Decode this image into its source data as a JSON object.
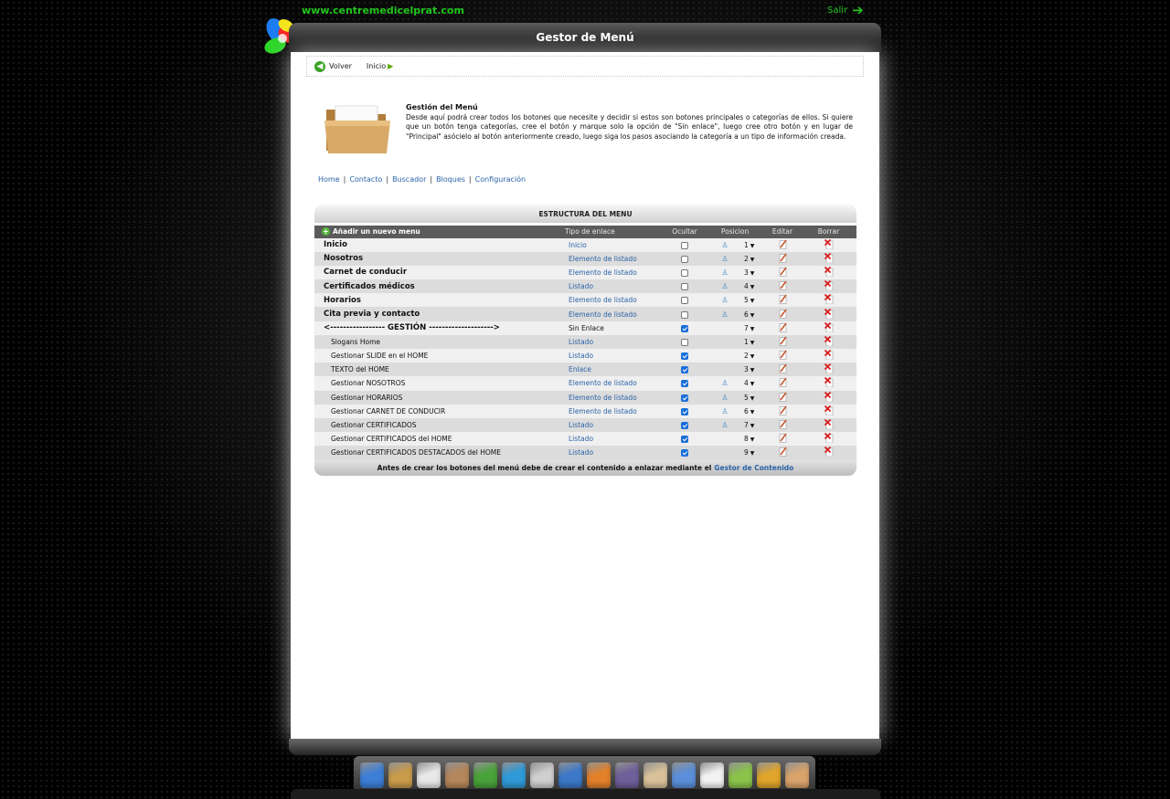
{
  "header": {
    "site_url": "www.centremedicelprat.com",
    "logout_label": "Salir",
    "page_title": "Gestor de Menú"
  },
  "breadcrumb": {
    "back_label": "Volver",
    "home_label": "Inicio"
  },
  "intro": {
    "title": "Gestión del Menú",
    "text": "Desde aquí podrá crear todos los botones que necesite y decidir si estos son botones principales o categorías de ellos. Si quiere que un botón tenga categorías, cree el botón y marque solo la opción de \"Sin enlace\", luego cree otro botón y en lugar de \"Principal\" asócielo al botón anteriormente creado, luego siga los pasos asociando la categoría a un tipo de información creada."
  },
  "quicklinks": [
    "Home",
    "Contacto",
    "Buscador",
    "Bloques",
    "Configuración"
  ],
  "menu_structure": {
    "title": "ESTRUCTURA DEL MENU",
    "add_label": "Añadir un nuevo menu",
    "columns": {
      "type": "Tipo de enlace",
      "hide": "Ocultar",
      "position": "Posicion",
      "edit": "Editar",
      "delete": "Borrar"
    },
    "rows": [
      {
        "name": "Inicio",
        "type": "Inicio",
        "hidden": false,
        "preview": true,
        "position": "1",
        "level": "main"
      },
      {
        "name": "Nosotros",
        "type": "Elemento de listado",
        "hidden": false,
        "preview": true,
        "position": "2",
        "level": "main"
      },
      {
        "name": "Carnet de conducir",
        "type": "Elemento de listado",
        "hidden": false,
        "preview": true,
        "position": "3",
        "level": "main"
      },
      {
        "name": "Certificados médicos",
        "type": "Listado",
        "hidden": false,
        "preview": true,
        "position": "4",
        "level": "main"
      },
      {
        "name": "Horarios",
        "type": "Elemento de listado",
        "hidden": false,
        "preview": true,
        "position": "5",
        "level": "main"
      },
      {
        "name": "Cita previa y contacto",
        "type": "Elemento de listado",
        "hidden": false,
        "preview": true,
        "position": "6",
        "level": "main"
      },
      {
        "name": "<----------------- GESTIÓN -------------------->",
        "type": "Sin Enlace",
        "hidden": true,
        "preview": false,
        "position": "7",
        "level": "main"
      },
      {
        "name": "Slogans Home",
        "type": "Listado",
        "hidden": false,
        "preview": false,
        "position": "1",
        "level": "sub"
      },
      {
        "name": "Gestionar SLIDE en el HOME",
        "type": "Listado",
        "hidden": true,
        "preview": false,
        "position": "2",
        "level": "sub"
      },
      {
        "name": "TEXTO del HOME",
        "type": "Enlace",
        "hidden": true,
        "preview": false,
        "position": "3",
        "level": "sub"
      },
      {
        "name": "Gestionar NOSOTROS",
        "type": "Elemento de listado",
        "hidden": true,
        "preview": true,
        "position": "4",
        "level": "sub"
      },
      {
        "name": "Gestionar HORARIOS",
        "type": "Elemento de listado",
        "hidden": true,
        "preview": true,
        "position": "5",
        "level": "sub"
      },
      {
        "name": "Gestionar CARNET DE CONDUCIR",
        "type": "Elemento de listado",
        "hidden": true,
        "preview": true,
        "position": "6",
        "level": "sub"
      },
      {
        "name": "Gestionar CERTIFICADOS",
        "type": "Listado",
        "hidden": true,
        "preview": true,
        "position": "7",
        "level": "sub"
      },
      {
        "name": "Gestionar CERTIFICADOS del HOME",
        "type": "Listado",
        "hidden": true,
        "preview": false,
        "position": "8",
        "level": "sub"
      },
      {
        "name": "Gestionar CERTIFICADOS DESTACADOS del HOME",
        "type": "Listado",
        "hidden": true,
        "preview": false,
        "position": "9",
        "level": "sub"
      }
    ],
    "footer_text": "Antes de crear los botones del menú debe de crear el contenido a enlazar mediante el",
    "footer_link": "Gestor de Contenido"
  },
  "dock_icons": [
    {
      "name": "home-icon",
      "color": "#3d7fd6"
    },
    {
      "name": "folder-icon",
      "color": "#c99b4a"
    },
    {
      "name": "notepad-icon",
      "color": "#e8e8e8"
    },
    {
      "name": "clipboard-icon",
      "color": "#b5875a"
    },
    {
      "name": "shopping-cart-icon",
      "color": "#4aa23a"
    },
    {
      "name": "discount-tag-icon",
      "color": "#2f9ad8"
    },
    {
      "name": "printer-icon",
      "color": "#cfcfcf"
    },
    {
      "name": "users-icon",
      "color": "#3b78c8"
    },
    {
      "name": "settings-gear-icon",
      "color": "#e3812b"
    },
    {
      "name": "monitor-icon",
      "color": "#6e5f9a"
    },
    {
      "name": "paypal-icon",
      "color": "#d9c29a"
    },
    {
      "name": "google-icon",
      "color": "#5b8fd9"
    },
    {
      "name": "envelope-icon",
      "color": "#f2f2f2"
    },
    {
      "name": "statistics-icon",
      "color": "#8bc34a"
    },
    {
      "name": "lock-icon",
      "color": "#e0a52a"
    },
    {
      "name": "handshake-icon",
      "color": "#d9a36b"
    }
  ]
}
